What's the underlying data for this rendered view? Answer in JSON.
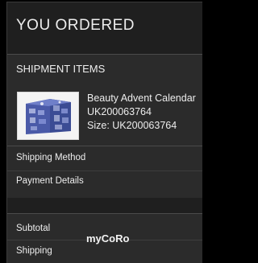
{
  "header": {
    "title": "YOU ORDERED"
  },
  "shipment": {
    "heading": "SHIPMENT ITEMS",
    "item": {
      "name": "Beauty Advent Calendar",
      "code": "UK200063764",
      "size": "Size: UK200063764"
    }
  },
  "details": {
    "shipping_method": "Shipping Method",
    "payment_details": "Payment Details"
  },
  "totals": {
    "subtotal": "Subtotal",
    "shipping": "Shipping"
  },
  "overlay": {
    "watermark": "myCoRo"
  }
}
